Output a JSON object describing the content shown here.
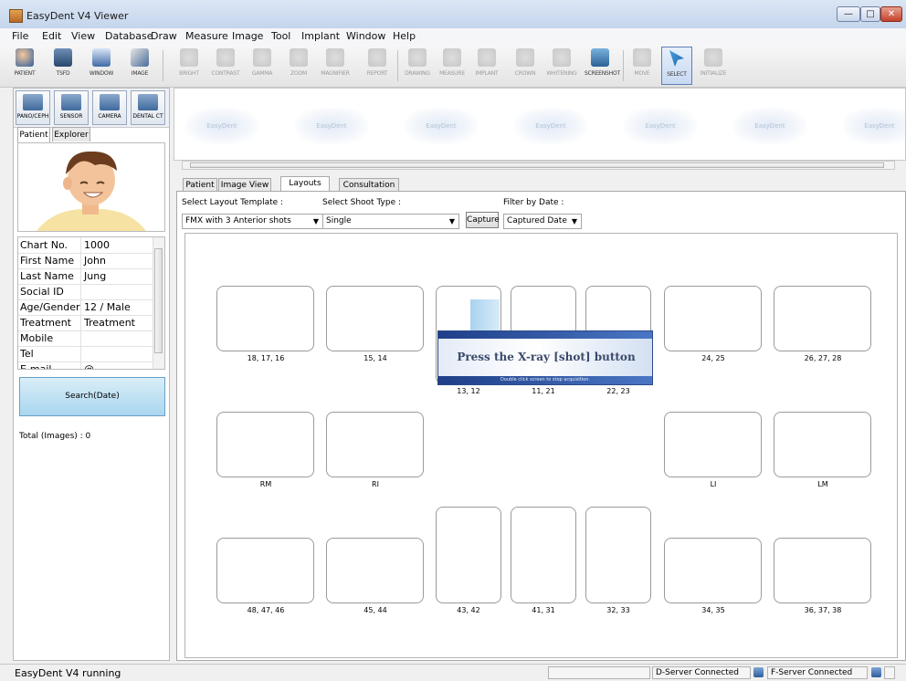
{
  "window": {
    "title": "EasyDent V4 Viewer",
    "min_glyph": "—",
    "max_glyph": "□",
    "close_glyph": "✕"
  },
  "menu": [
    {
      "label": "File",
      "ul": "F"
    },
    {
      "label": "Edit",
      "ul": "E"
    },
    {
      "label": "View",
      "ul": "V"
    },
    {
      "label": "Database",
      "ul": "b"
    },
    {
      "label": "Draw",
      "ul": "D"
    },
    {
      "label": "Measure",
      "ul": "M"
    },
    {
      "label": "Image",
      "ul": "g"
    },
    {
      "label": "Tool",
      "ul": "T"
    },
    {
      "label": "Implant",
      "ul": "I"
    },
    {
      "label": "Window",
      "ul": "W"
    },
    {
      "label": "Help",
      "ul": "H"
    }
  ],
  "toolbar": {
    "patient": "PATIENT",
    "tsfd": "TSFD",
    "window": "WINDOW",
    "image": "IMAGE",
    "bright": "BRIGHT",
    "contrast": "CONTRAST",
    "gamma": "GAMMA",
    "zoom": "ZOOM",
    "magnifier": "MAGNIFIER",
    "report": "REPORT",
    "drawing": "DRAWING",
    "measure": "MEASURE",
    "implant": "IMPLANT",
    "crown": "CROWN",
    "whitening": "WHITENING",
    "screenshot": "SCREENSHOT",
    "move": "MOVE",
    "select": "SELECT",
    "initialize": "INITIALIZE"
  },
  "devices": {
    "panocephalo": "PANO/CEPH",
    "sensor": "SENSOR",
    "camera": "CAMERA",
    "dental_ct": "DENTAL CT"
  },
  "left_tabs": {
    "patient": "Patient",
    "explorer": "Explorer"
  },
  "patient_info": [
    {
      "key": "Chart No.",
      "value": "1000"
    },
    {
      "key": "First Name",
      "value": "John"
    },
    {
      "key": "Last Name",
      "value": "Jung"
    },
    {
      "key": "Social ID",
      "value": ""
    },
    {
      "key": "Age/Gender",
      "value": "12 / Male"
    },
    {
      "key": "Treatment",
      "value": "Treatment"
    },
    {
      "key": "Mobile",
      "value": ""
    },
    {
      "key": "Tel",
      "value": ""
    },
    {
      "key": "E-mail",
      "value": "@"
    }
  ],
  "search_button": "Search(Date)",
  "total_images": "Total (Images) : 0",
  "watermark": "EasyDent",
  "main_tabs": {
    "patient": "Patient",
    "image_view": "Image View",
    "layouts": "Layouts",
    "consultation": "Consultation"
  },
  "controls": {
    "layout_template_label": "Select Layout Template :",
    "layout_template_value": "FMX with 3 Anterior shots",
    "shoot_type_label": "Select Shoot Type :",
    "shoot_type_value": "Single",
    "capture_button": "Capture",
    "filter_label": "Filter by Date :",
    "filter_value": "Captured Date",
    "arrow": "▼"
  },
  "slot_labels": {
    "s1": "18, 17, 16",
    "s2": "15, 14",
    "s3": "13, 12",
    "s4": "11, 21",
    "s5": "22, 23",
    "s6": "24, 25",
    "s7": "26, 27, 28",
    "s8": "RM",
    "s9": "RI",
    "s10": "LI",
    "s11": "LM",
    "s12": "48, 47, 46",
    "s13": "45, 44",
    "s14": "43, 42",
    "s15": "41, 31",
    "s16": "32, 33",
    "s17": "34, 35",
    "s18": "36, 37, 38"
  },
  "dialog": {
    "message": "Press the X-ray [shot] button",
    "hint": "Double click screen to stop acquisition."
  },
  "status": {
    "text": "EasyDent V4 running",
    "d_server": "D-Server Connected",
    "f_server": "F-Server Connected"
  }
}
